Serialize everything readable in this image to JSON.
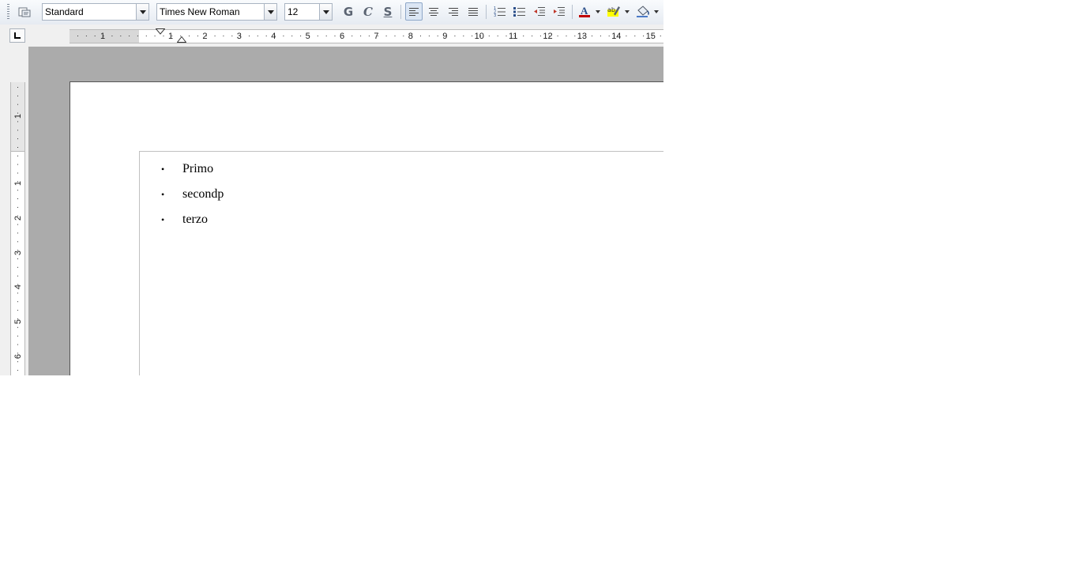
{
  "toolbar": {
    "paragraph_style": "Standard",
    "font_name": "Times New Roman",
    "font_size": "12",
    "bold_glyph": "G",
    "italic_glyph": "C",
    "underline_glyph": "S",
    "font_color": "#c00000",
    "highlight_color": "#ffff00"
  },
  "ruler": {
    "horizontal_left_numbers": [
      "1"
    ],
    "horizontal_numbers": [
      "1",
      "2",
      "3",
      "4",
      "5",
      "6",
      "7",
      "8",
      "9",
      "10",
      "11",
      "12",
      "13",
      "14",
      "15"
    ],
    "vertical_numbers": [
      "1",
      "1",
      "2",
      "3",
      "4",
      "5",
      "6"
    ]
  },
  "document": {
    "list_items": [
      {
        "bullet": "•",
        "text": "Primo"
      },
      {
        "bullet": "•",
        "text": "secondp"
      },
      {
        "bullet": "•",
        "text": "terzo"
      }
    ]
  }
}
